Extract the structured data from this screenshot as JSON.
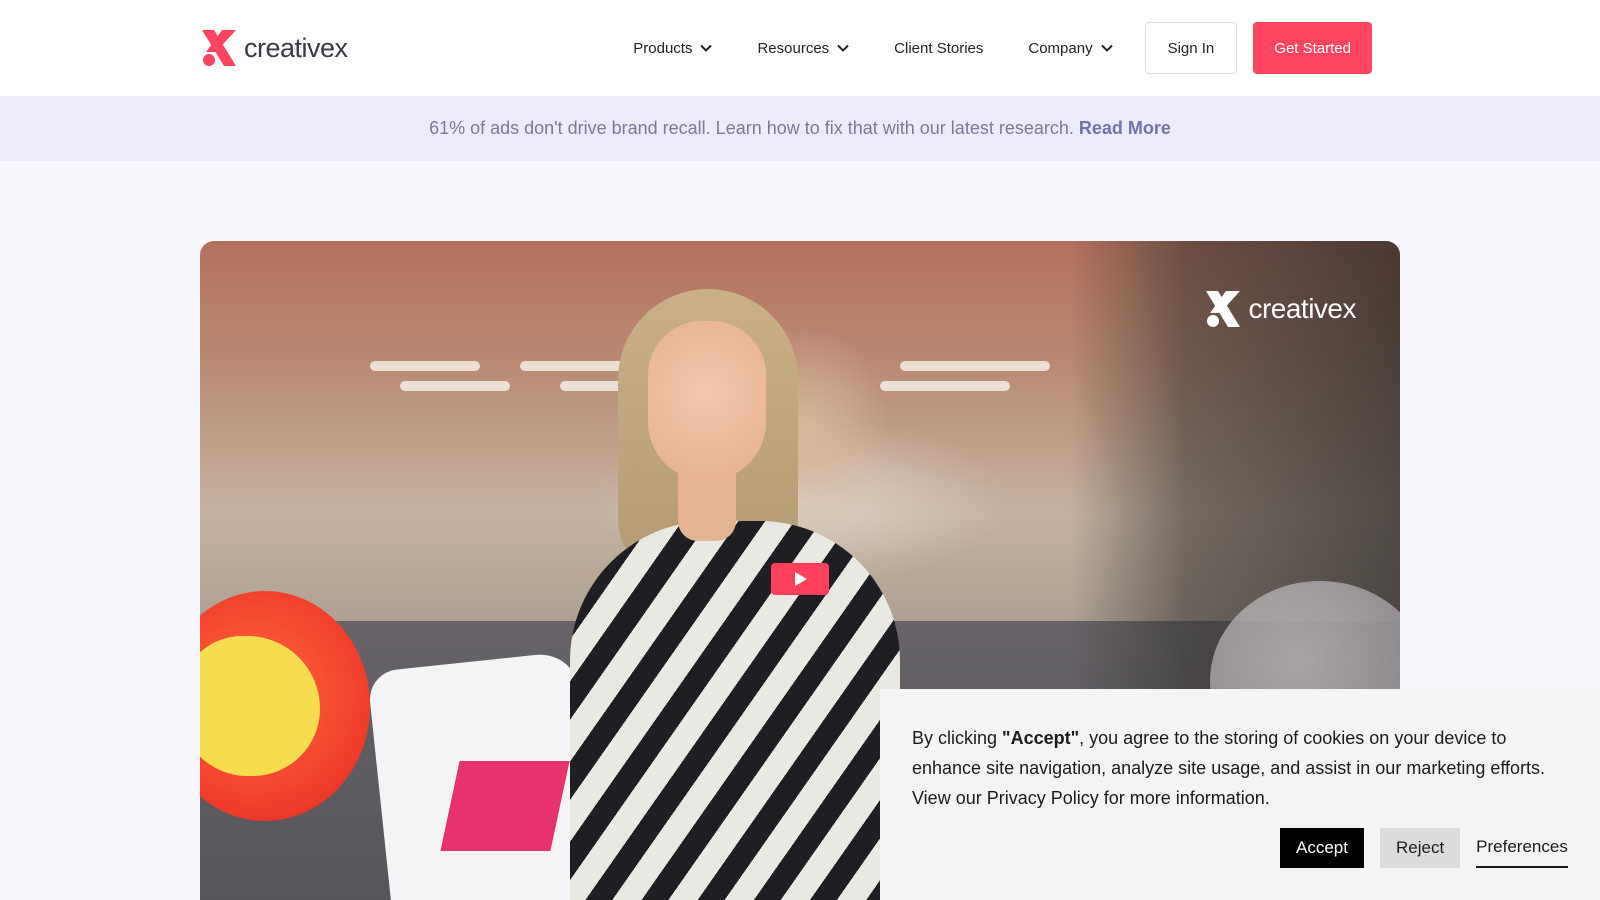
{
  "brand": {
    "name": "creativex",
    "accent_color": "#ff4461"
  },
  "header": {
    "nav": [
      {
        "label": "Products",
        "has_dropdown": true
      },
      {
        "label": "Resources",
        "has_dropdown": true
      },
      {
        "label": "Client Stories",
        "has_dropdown": false
      },
      {
        "label": "Company",
        "has_dropdown": true
      }
    ],
    "sign_in_label": "Sign In",
    "get_started_label": "Get Started"
  },
  "announcement": {
    "text": "61% of ads don't drive brand recall. Learn how to fix that with our latest research.",
    "link_label": "Read More"
  },
  "video": {
    "overlay_logo_text": "creativex",
    "play_icon": "play-icon"
  },
  "cookie_banner": {
    "text_before": "By clicking ",
    "text_bold": "\"Accept\"",
    "text_after": ", you agree to the storing of cookies on your device to enhance site navigation, analyze site usage, and assist in our marketing efforts. View our Privacy Policy for more information.",
    "accept_label": "Accept",
    "reject_label": "Reject",
    "preferences_label": "Preferences"
  }
}
